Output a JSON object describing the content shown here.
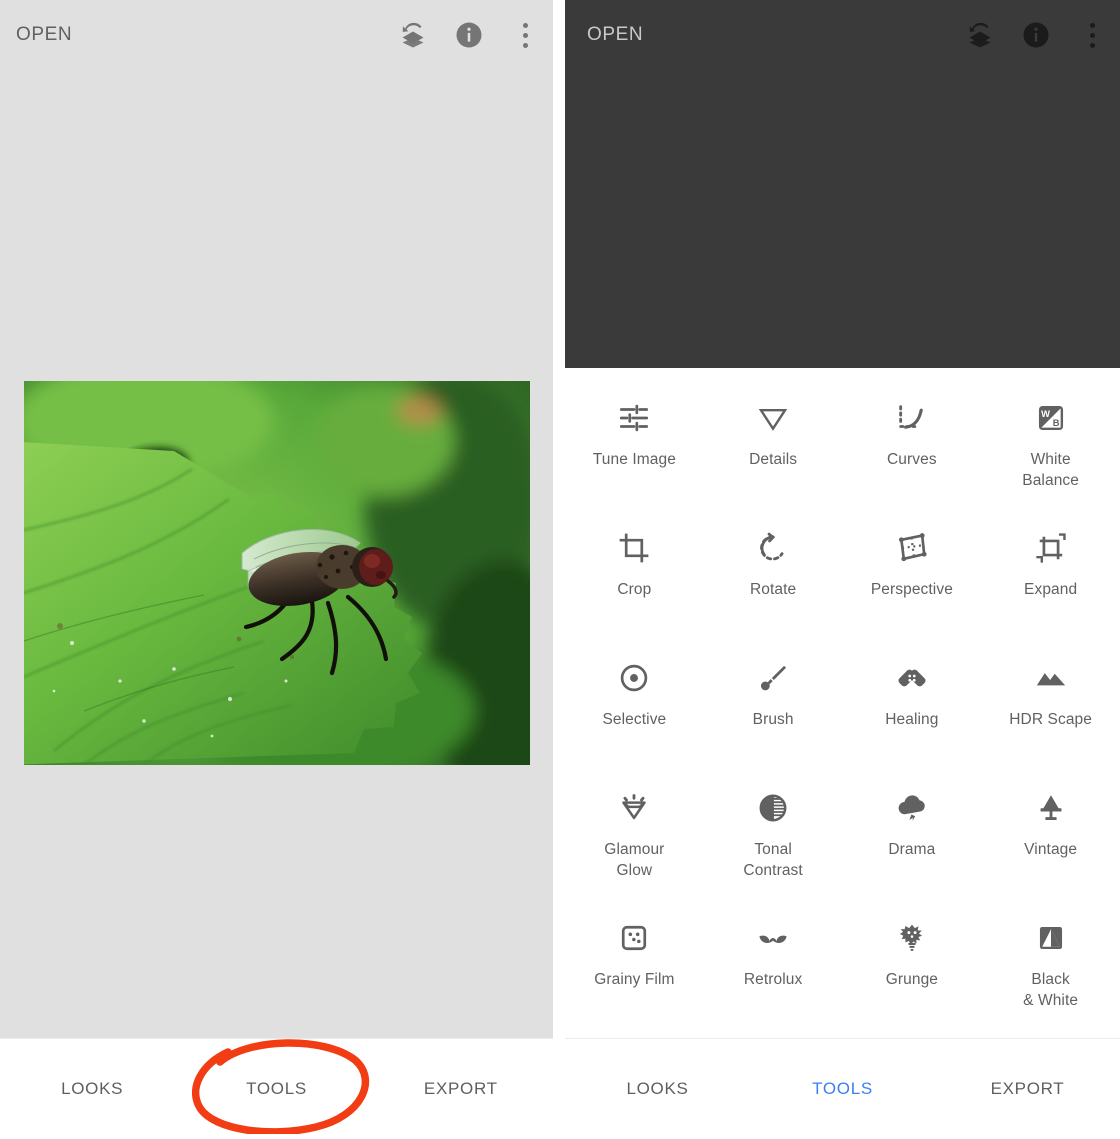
{
  "app": {
    "title": "OPEN",
    "accent_active": "#3b7ff2",
    "annotation_color": "#f23c13",
    "left_bg": "#e0e0e0",
    "right_bg": "#3a3a3a",
    "icon_color": "#616161"
  },
  "appbar": {
    "title": "OPEN",
    "actions": [
      {
        "name": "revert-stack-icon",
        "label": "Revert"
      },
      {
        "name": "info-icon",
        "label": "Info"
      },
      {
        "name": "overflow-menu-icon",
        "label": "More options"
      }
    ]
  },
  "left_panel": {
    "title": "OPEN",
    "photo_alt": "Macro photo of a house fly resting on a green serrated leaf",
    "nav": [
      {
        "label": "LOOKS",
        "active": false
      },
      {
        "label": "TOOLS",
        "active": false,
        "annotated": true
      },
      {
        "label": "EXPORT",
        "active": false
      }
    ]
  },
  "right_panel": {
    "title": "OPEN",
    "tools": [
      {
        "label": "Tune Image",
        "icon": "tune-image-icon"
      },
      {
        "label": "Details",
        "icon": "details-icon"
      },
      {
        "label": "Curves",
        "icon": "curves-icon"
      },
      {
        "label": "White\nBalance",
        "icon": "white-balance-icon"
      },
      {
        "label": "Crop",
        "icon": "crop-icon"
      },
      {
        "label": "Rotate",
        "icon": "rotate-icon"
      },
      {
        "label": "Perspective",
        "icon": "perspective-icon"
      },
      {
        "label": "Expand",
        "icon": "expand-icon"
      },
      {
        "label": "Selective",
        "icon": "selective-icon"
      },
      {
        "label": "Brush",
        "icon": "brush-icon"
      },
      {
        "label": "Healing",
        "icon": "healing-icon"
      },
      {
        "label": "HDR Scape",
        "icon": "hdr-scape-icon"
      },
      {
        "label": "Glamour\nGlow",
        "icon": "glamour-glow-icon"
      },
      {
        "label": "Tonal\nContrast",
        "icon": "tonal-contrast-icon"
      },
      {
        "label": "Drama",
        "icon": "drama-icon"
      },
      {
        "label": "Vintage",
        "icon": "vintage-icon"
      },
      {
        "label": "Grainy Film",
        "icon": "grainy-film-icon"
      },
      {
        "label": "Retrolux",
        "icon": "retrolux-icon"
      },
      {
        "label": "Grunge",
        "icon": "grunge-icon"
      },
      {
        "label": "Black\n& White",
        "icon": "black-and-white-icon"
      }
    ],
    "nav": [
      {
        "label": "LOOKS",
        "active": false
      },
      {
        "label": "TOOLS",
        "active": true
      },
      {
        "label": "EXPORT",
        "active": false
      }
    ]
  }
}
